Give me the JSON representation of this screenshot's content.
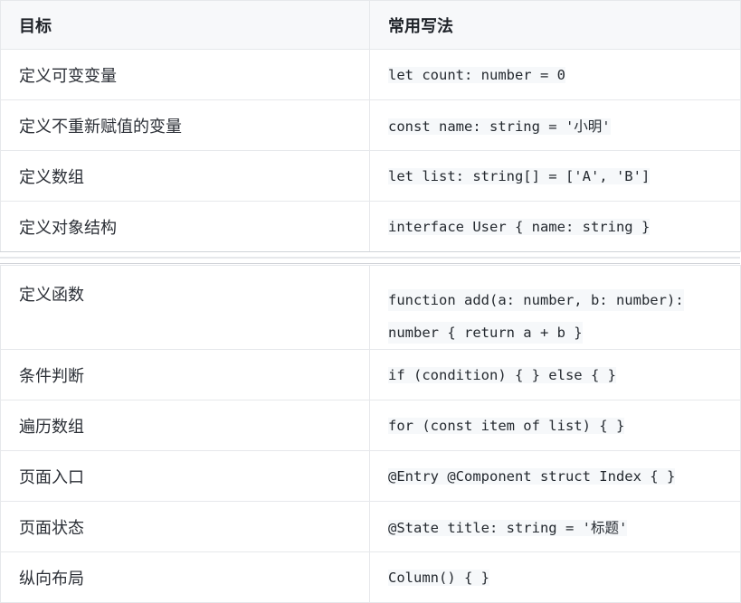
{
  "header": {
    "col_goal": "目标",
    "col_usage": "常用写法"
  },
  "rows_top": [
    {
      "goal": "定义可变变量",
      "code": "let count: number = 0"
    },
    {
      "goal": "定义不重新赋值的变量",
      "code": "const name: string = '小明'"
    },
    {
      "goal": "定义数组",
      "code": "let list: string[] = ['A', 'B']"
    },
    {
      "goal": "定义对象结构",
      "code": "interface User { name: string }"
    }
  ],
  "rows_bottom": [
    {
      "goal": "定义函数",
      "code": "function add(a: number, b: number): number { return a + b }"
    },
    {
      "goal": "条件判断",
      "code": "if (condition) { } else { }"
    },
    {
      "goal": "遍历数组",
      "code": "for (const item of list) { }"
    },
    {
      "goal": "页面入口",
      "code": "@Entry @Component struct Index { }"
    },
    {
      "goal": "页面状态",
      "code": "@State title: string = '标题'"
    },
    {
      "goal": "纵向布局",
      "code": "Column() { }"
    }
  ]
}
